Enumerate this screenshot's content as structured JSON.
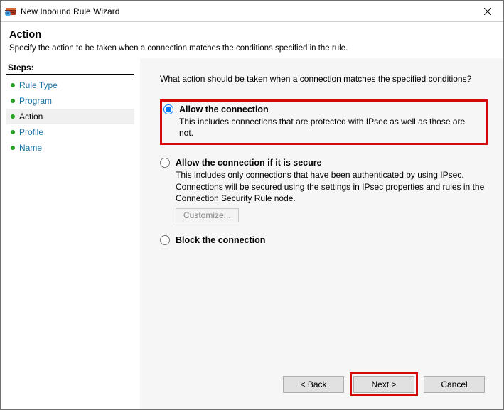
{
  "titlebar": {
    "title": "New Inbound Rule Wizard"
  },
  "header": {
    "heading": "Action",
    "sub": "Specify the action to be taken when a connection matches the conditions specified in the rule."
  },
  "sidebar": {
    "title": "Steps:",
    "items": [
      {
        "label": "Rule Type"
      },
      {
        "label": "Program"
      },
      {
        "label": "Action"
      },
      {
        "label": "Profile"
      },
      {
        "label": "Name"
      }
    ]
  },
  "main": {
    "prompt": "What action should be taken when a connection matches the specified conditions?",
    "options": [
      {
        "label": "Allow the connection",
        "desc": "This includes connections that are protected with IPsec as well as those are not."
      },
      {
        "label": "Allow the connection if it is secure",
        "desc": "This includes only connections that have been authenticated by using IPsec.  Connections will be secured using the settings in IPsec properties and rules in the Connection Security Rule node.",
        "customize": "Customize..."
      },
      {
        "label": "Block the connection"
      }
    ]
  },
  "footer": {
    "back": "< Back",
    "next": "Next >",
    "cancel": "Cancel"
  }
}
